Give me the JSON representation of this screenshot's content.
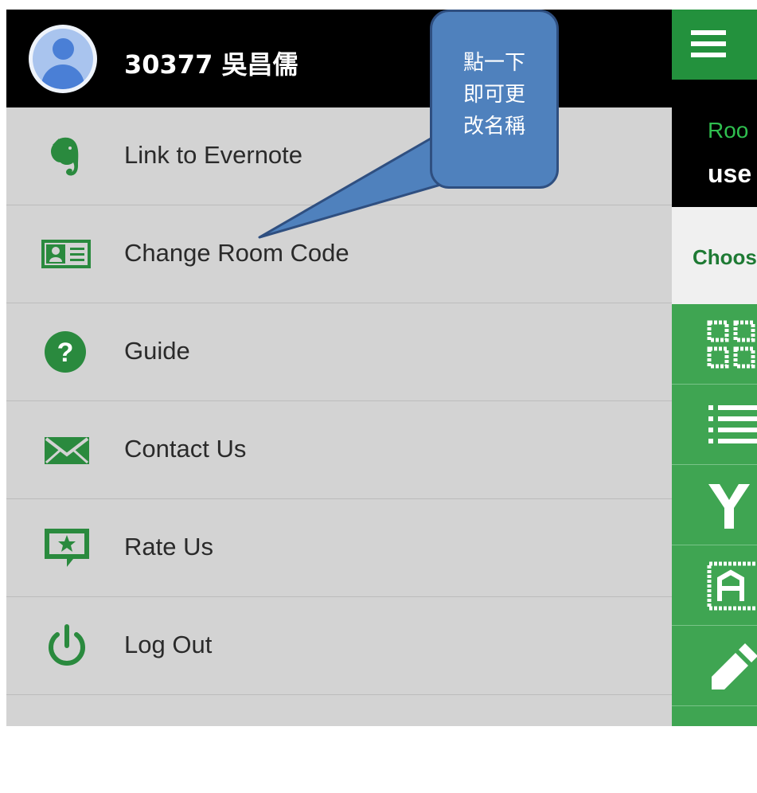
{
  "drawer": {
    "user_name": "30377 吳昌儒",
    "items": [
      {
        "label": "Link to Evernote",
        "icon": "evernote-icon"
      },
      {
        "label": "Change Room Code",
        "icon": "id-card-icon"
      },
      {
        "label": "Guide",
        "icon": "help-circle-icon"
      },
      {
        "label": "Contact Us",
        "icon": "envelope-icon"
      },
      {
        "label": "Rate Us",
        "icon": "star-feedback-icon"
      },
      {
        "label": "Log Out",
        "icon": "power-icon"
      }
    ]
  },
  "callout": {
    "text": "點一下\n即可更\n改名稱"
  },
  "main": {
    "room_label": "Roo",
    "room_value": "use",
    "choose_text": "Choos",
    "option_icons": [
      "qr-code-icon",
      "list-icon",
      "yes-no-icon",
      "abcd-icon",
      "pencil-icon"
    ]
  },
  "colors": {
    "accent_green": "#23913d",
    "icon_green": "#2a8a3e",
    "callout_blue": "#4f81bd",
    "drawer_gray": "#d3d3d3"
  }
}
